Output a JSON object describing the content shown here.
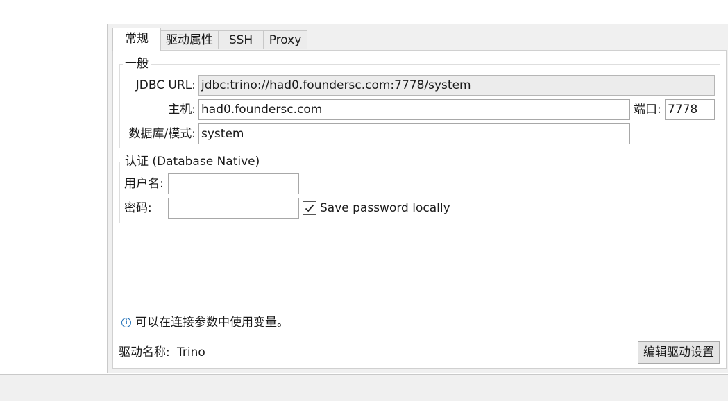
{
  "tabs": [
    {
      "label": "常规",
      "active": true
    },
    {
      "label": "驱动属性",
      "active": false
    },
    {
      "label": "SSH",
      "active": false
    },
    {
      "label": "Proxy",
      "active": false
    }
  ],
  "general": {
    "legend": "一般",
    "jdbc_url_label": "JDBC URL:",
    "jdbc_url_value": "jdbc:trino://had0.foundersc.com:7778/system",
    "host_label": "主机:",
    "host_value": "had0.foundersc.com",
    "port_label": "端口:",
    "port_value": "7778",
    "database_label": "数据库/模式:",
    "database_value": "system"
  },
  "auth": {
    "legend": "认证 (Database Native)",
    "username_label": "用户名:",
    "username_value": "",
    "password_label": "密码:",
    "password_value": "",
    "save_password_label": "Save password locally",
    "save_password_checked": true
  },
  "info": {
    "icon": "info-icon",
    "text": "可以在连接参数中使用变量。"
  },
  "driver": {
    "name_label": "驱动名称:",
    "name_value": "Trino",
    "edit_button_label": "编辑驱动设置"
  },
  "colors": {
    "panel_bg": "#f0f0f0",
    "readonly_field_bg": "#ececec",
    "info_icon": "#1f6fb8"
  }
}
